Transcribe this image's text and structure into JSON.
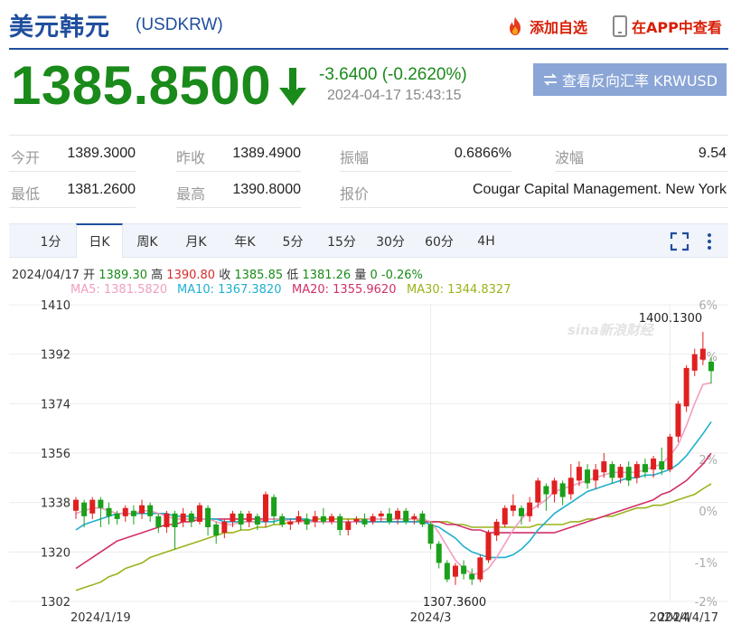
{
  "header": {
    "title": "美元韩元",
    "code": "(USDKRW)",
    "add_label": "添加自选",
    "app_label": "在APP中查看"
  },
  "quote": {
    "price": "1385.8500",
    "change": "-3.6400 (-0.2620%)",
    "time": "2024-04-17 15:43:15",
    "reverse_label": "查看反向汇率 KRWUSD"
  },
  "stats": [
    {
      "label": "今开",
      "value": "1389.3000"
    },
    {
      "label": "昨收",
      "value": "1389.4900"
    },
    {
      "label": "振幅",
      "value": "0.6866%"
    },
    {
      "label": "波幅",
      "value": "9.54"
    },
    {
      "label": "最低",
      "value": "1381.2600"
    },
    {
      "label": "最高",
      "value": "1390.8000"
    },
    {
      "label": "报价",
      "value": "Cougar Capital Management. New York"
    }
  ],
  "tabs": [
    "1分",
    "日K",
    "周K",
    "月K",
    "年K",
    "5分",
    "15分",
    "30分",
    "60分",
    "4H"
  ],
  "active_tab": "日K",
  "ohlc": {
    "date": "2024/04/17",
    "open_label": "开",
    "open": "1389.30",
    "high_label": "高",
    "high": "1390.80",
    "close_label": "收",
    "close": "1385.85",
    "low_label": "低",
    "low": "1381.26",
    "vol_label": "量",
    "vol": "0",
    "pct": "-0.26%"
  },
  "ma": [
    {
      "label": "MA5: 1381.5820",
      "color": "#f19ec2"
    },
    {
      "label": "MA10: 1367.3820",
      "color": "#1fb0cf"
    },
    {
      "label": "MA20: 1355.9620",
      "color": "#d2306b"
    },
    {
      "label": "MA30: 1344.8327",
      "color": "#9bb31a"
    }
  ],
  "chart_data": {
    "type": "candlestick",
    "y_ticks": [
      "1410",
      "1392",
      "1374",
      "1356",
      "1338",
      "1320",
      "1302"
    ],
    "ylim": [
      1302,
      1410
    ],
    "pct_ticks": [
      "6%",
      "4%",
      "2%",
      "0%",
      "-1%",
      "-2%"
    ],
    "x_ticks": [
      "2024/1/19",
      "2024/3",
      "2024/4",
      "2024/4/17"
    ],
    "annotations": {
      "high": "1400.1300",
      "low": "1307.3600"
    },
    "watermark": "sina新浪财经",
    "up_color": "#e02020",
    "down_color": "#1aa01a",
    "candles": [
      [
        1335,
        1339,
        1332,
        1340
      ],
      [
        1338,
        1333,
        1329,
        1339
      ],
      [
        1334,
        1339,
        1332,
        1340
      ],
      [
        1339,
        1336,
        1329,
        1340
      ],
      [
        1336,
        1333,
        1330,
        1338
      ],
      [
        1334,
        1332,
        1330,
        1335
      ],
      [
        1333,
        1336,
        1331,
        1337
      ],
      [
        1335,
        1333,
        1330,
        1337
      ],
      [
        1334,
        1337,
        1332,
        1339
      ],
      [
        1337,
        1333,
        1331,
        1338
      ],
      [
        1333,
        1329,
        1327,
        1334
      ],
      [
        1329,
        1334,
        1327,
        1335
      ],
      [
        1334,
        1329,
        1321,
        1335
      ],
      [
        1331,
        1334,
        1329,
        1336
      ],
      [
        1334,
        1331,
        1329,
        1335
      ],
      [
        1331,
        1337,
        1330,
        1338
      ],
      [
        1336,
        1329,
        1326,
        1337
      ],
      [
        1330,
        1326,
        1323,
        1331
      ],
      [
        1327,
        1331,
        1325,
        1332
      ],
      [
        1331,
        1334,
        1329,
        1335
      ],
      [
        1334,
        1330,
        1328,
        1335
      ],
      [
        1331,
        1334,
        1329,
        1335
      ],
      [
        1333,
        1330,
        1328,
        1334
      ],
      [
        1331,
        1341,
        1329,
        1342
      ],
      [
        1340,
        1333,
        1330,
        1341
      ],
      [
        1333,
        1330,
        1329,
        1334
      ],
      [
        1330,
        1331,
        1328,
        1332
      ],
      [
        1331,
        1333,
        1330,
        1335
      ],
      [
        1332,
        1330,
        1328,
        1334
      ],
      [
        1331,
        1333,
        1329,
        1335
      ],
      [
        1333,
        1331,
        1330,
        1336
      ],
      [
        1331,
        1333,
        1330,
        1334
      ],
      [
        1333,
        1328,
        1326,
        1334
      ],
      [
        1328,
        1331,
        1326,
        1332
      ],
      [
        1331,
        1332,
        1330,
        1333
      ],
      [
        1332,
        1330,
        1329,
        1334
      ],
      [
        1331,
        1333,
        1330,
        1334
      ],
      [
        1333,
        1334,
        1331,
        1335
      ],
      [
        1334,
        1331,
        1330,
        1336
      ],
      [
        1332,
        1335,
        1330,
        1336
      ],
      [
        1335,
        1331,
        1330,
        1336
      ],
      [
        1332,
        1333,
        1330,
        1334
      ],
      [
        1334,
        1330,
        1329,
        1335
      ],
      [
        1330,
        1323,
        1321,
        1331
      ],
      [
        1323,
        1316,
        1314,
        1324
      ],
      [
        1316,
        1310,
        1309,
        1317
      ],
      [
        1311,
        1315,
        1308,
        1316
      ],
      [
        1315,
        1312,
        1310,
        1317
      ],
      [
        1312,
        1310,
        1308,
        1314
      ],
      [
        1310,
        1318,
        1309,
        1319
      ],
      [
        1317,
        1327,
        1316,
        1328
      ],
      [
        1326,
        1331,
        1324,
        1332
      ],
      [
        1330,
        1336,
        1329,
        1337
      ],
      [
        1335,
        1337,
        1333,
        1341
      ],
      [
        1336,
        1333,
        1330,
        1337
      ],
      [
        1333,
        1338,
        1331,
        1340
      ],
      [
        1338,
        1346,
        1336,
        1347
      ],
      [
        1344,
        1341,
        1335,
        1345
      ],
      [
        1341,
        1346,
        1338,
        1347
      ],
      [
        1345,
        1340,
        1337,
        1346
      ],
      [
        1341,
        1347,
        1339,
        1352
      ],
      [
        1346,
        1351,
        1344,
        1353
      ],
      [
        1350,
        1345,
        1343,
        1352
      ],
      [
        1346,
        1350,
        1343,
        1352
      ],
      [
        1349,
        1353,
        1347,
        1356
      ],
      [
        1352,
        1347,
        1345,
        1353
      ],
      [
        1347,
        1351,
        1345,
        1352
      ],
      [
        1351,
        1346,
        1344,
        1353
      ],
      [
        1347,
        1352,
        1345,
        1353
      ],
      [
        1352,
        1349,
        1347,
        1354
      ],
      [
        1350,
        1354,
        1347,
        1355
      ],
      [
        1353,
        1350,
        1348,
        1358
      ],
      [
        1350,
        1362,
        1349,
        1363
      ],
      [
        1362,
        1374,
        1360,
        1375
      ],
      [
        1373,
        1387,
        1371,
        1388
      ],
      [
        1386,
        1392,
        1384,
        1394
      ],
      [
        1390,
        1394,
        1388,
        1400.13
      ],
      [
        1389.3,
        1385.85,
        1381.26,
        1390.8
      ]
    ],
    "ma5": [
      1334,
      1335,
      1336,
      1336,
      1335,
      1334,
      1334,
      1334,
      1335,
      1335,
      1334,
      1333,
      1332,
      1332,
      1332,
      1332,
      1332,
      1331,
      1330,
      1330,
      1331,
      1331,
      1331,
      1332,
      1332,
      1332,
      1331,
      1331,
      1331,
      1331,
      1331,
      1331,
      1331,
      1331,
      1331,
      1332,
      1332,
      1332,
      1332,
      1332,
      1332,
      1332,
      1332,
      1331,
      1327,
      1322,
      1317,
      1314,
      1312,
      1312,
      1314,
      1318,
      1323,
      1328,
      1332,
      1335,
      1337,
      1339,
      1342,
      1343,
      1344,
      1345,
      1346,
      1347,
      1348,
      1349,
      1349,
      1349,
      1349,
      1350,
      1351,
      1352,
      1355,
      1359,
      1366,
      1374,
      1381,
      1381.58
    ],
    "ma10": [
      1328,
      1330,
      1331,
      1332,
      1333,
      1334,
      1334,
      1334,
      1334,
      1334,
      1334,
      1334,
      1333,
      1333,
      1333,
      1332,
      1332,
      1332,
      1331,
      1331,
      1331,
      1331,
      1331,
      1331,
      1331,
      1332,
      1332,
      1332,
      1332,
      1331,
      1331,
      1331,
      1331,
      1331,
      1331,
      1331,
      1331,
      1331,
      1331,
      1331,
      1331,
      1331,
      1331,
      1330,
      1329,
      1327,
      1325,
      1322,
      1320,
      1319,
      1318,
      1318,
      1318,
      1319,
      1321,
      1324,
      1328,
      1331,
      1334,
      1336,
      1338,
      1340,
      1342,
      1343,
      1344,
      1345,
      1346,
      1347,
      1347,
      1348,
      1348,
      1349,
      1350,
      1352,
      1355,
      1359,
      1363,
      1367.38
    ],
    "ma20": [
      1314,
      1316,
      1318,
      1320,
      1322,
      1324,
      1325,
      1326,
      1327,
      1328,
      1329,
      1330,
      1330,
      1331,
      1331,
      1332,
      1332,
      1332,
      1332,
      1332,
      1332,
      1332,
      1332,
      1332,
      1332,
      1332,
      1332,
      1332,
      1331,
      1331,
      1331,
      1331,
      1331,
      1331,
      1331,
      1331,
      1331,
      1331,
      1331,
      1331,
      1331,
      1331,
      1331,
      1331,
      1331,
      1330,
      1330,
      1329,
      1328,
      1328,
      1327,
      1327,
      1327,
      1327,
      1327,
      1327,
      1327,
      1327,
      1327,
      1328,
      1329,
      1330,
      1331,
      1332,
      1333,
      1334,
      1335,
      1336,
      1337,
      1338,
      1339,
      1341,
      1342,
      1344,
      1346,
      1349,
      1352,
      1355.96
    ],
    "ma30": [
      1306,
      1307,
      1308,
      1309,
      1311,
      1312,
      1314,
      1315,
      1316,
      1318,
      1319,
      1320,
      1321,
      1322,
      1323,
      1324,
      1325,
      1326,
      1327,
      1327,
      1328,
      1328,
      1329,
      1329,
      1330,
      1330,
      1331,
      1331,
      1331,
      1332,
      1332,
      1332,
      1332,
      1332,
      1332,
      1332,
      1332,
      1332,
      1332,
      1332,
      1332,
      1332,
      1331,
      1331,
      1331,
      1331,
      1330,
      1330,
      1329,
      1329,
      1329,
      1329,
      1329,
      1329,
      1329,
      1329,
      1330,
      1330,
      1330,
      1330,
      1331,
      1331,
      1332,
      1332,
      1333,
      1333,
      1334,
      1335,
      1336,
      1336,
      1337,
      1337,
      1338,
      1339,
      1340,
      1341,
      1343,
      1344.83
    ]
  }
}
